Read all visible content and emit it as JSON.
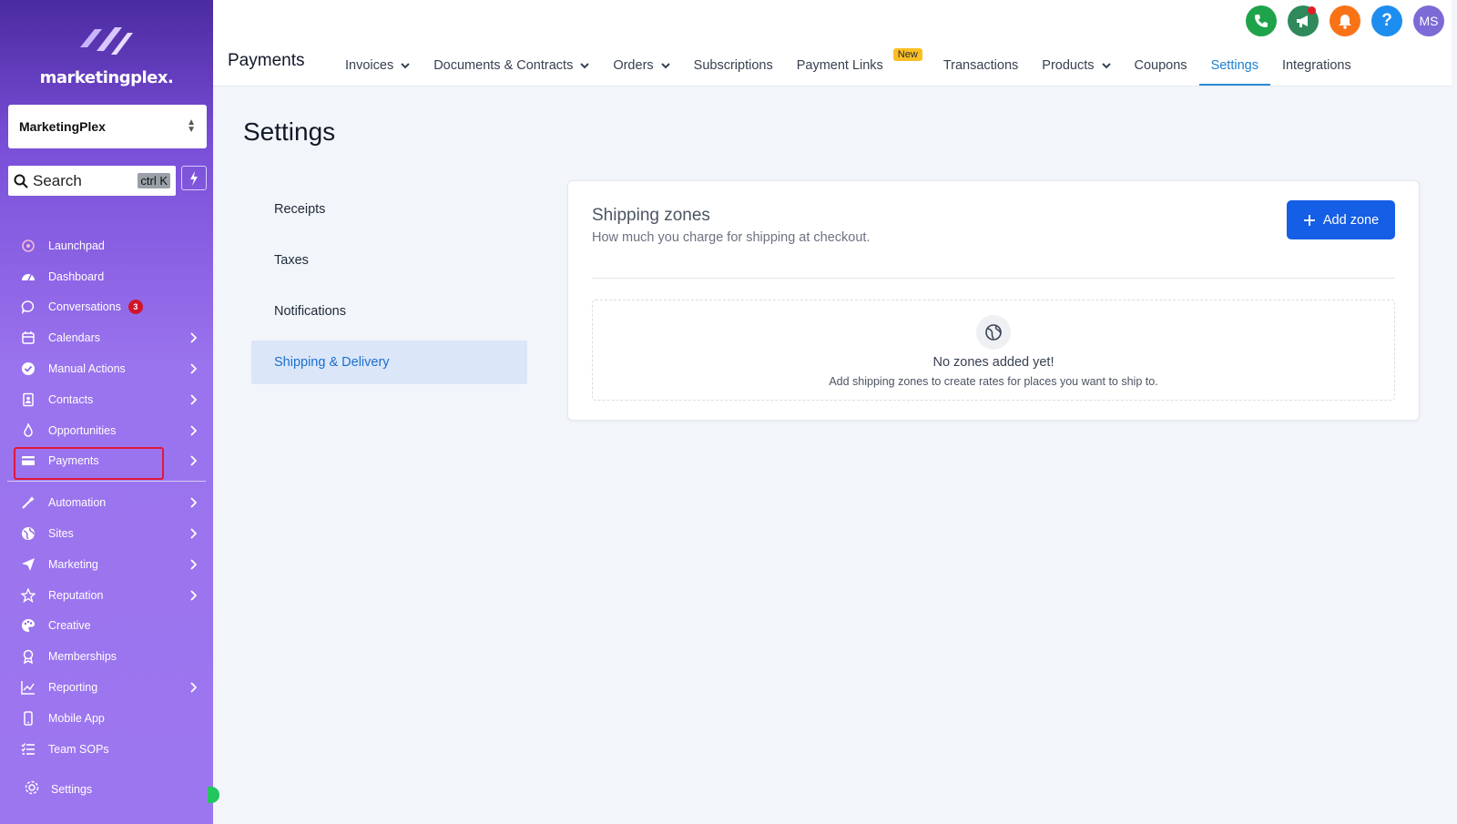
{
  "sidebar": {
    "brand": "marketingplex.",
    "account": "MarketingPlex",
    "search_placeholder": "Search",
    "search_shortcut": "ctrl K",
    "items": [
      {
        "label": "Launchpad"
      },
      {
        "label": "Dashboard"
      },
      {
        "label": "Conversations",
        "badge": "3"
      },
      {
        "label": "Calendars"
      },
      {
        "label": "Manual Actions"
      },
      {
        "label": "Contacts"
      },
      {
        "label": "Opportunities"
      },
      {
        "label": "Payments"
      },
      {
        "label": "Automation"
      },
      {
        "label": "Sites"
      },
      {
        "label": "Marketing"
      },
      {
        "label": "Reputation"
      },
      {
        "label": "Creative"
      },
      {
        "label": "Memberships"
      },
      {
        "label": "Reporting"
      },
      {
        "label": "Mobile App"
      },
      {
        "label": "Team SOPs"
      }
    ],
    "settings_label": "Settings"
  },
  "header": {
    "module_title": "Payments",
    "avatar_initials": "MS",
    "help_glyph": "?",
    "tabs": [
      {
        "label": "Invoices"
      },
      {
        "label": "Documents & Contracts"
      },
      {
        "label": "Orders"
      },
      {
        "label": "Subscriptions"
      },
      {
        "label": "Payment Links",
        "badge": "New"
      },
      {
        "label": "Transactions"
      },
      {
        "label": "Products"
      },
      {
        "label": "Coupons"
      },
      {
        "label": "Settings"
      },
      {
        "label": "Integrations"
      }
    ]
  },
  "main": {
    "page_title": "Settings",
    "settings_nav": [
      {
        "label": "Receipts"
      },
      {
        "label": "Taxes"
      },
      {
        "label": "Notifications"
      },
      {
        "label": "Shipping & Delivery"
      }
    ],
    "card": {
      "title": "Shipping zones",
      "subtitle": "How much you charge for shipping at checkout.",
      "add_button": "Add zone",
      "empty_title": "No zones added yet!",
      "empty_subtitle": "Add shipping zones to create rates for places you want to ship to."
    }
  },
  "colors": {
    "accent": "#155ee6",
    "active_tab": "#1d7fd1",
    "sidebar_top": "#4b2ba0",
    "sidebar_bottom": "#9c76ef",
    "highlight_outline": "#e0183a"
  }
}
